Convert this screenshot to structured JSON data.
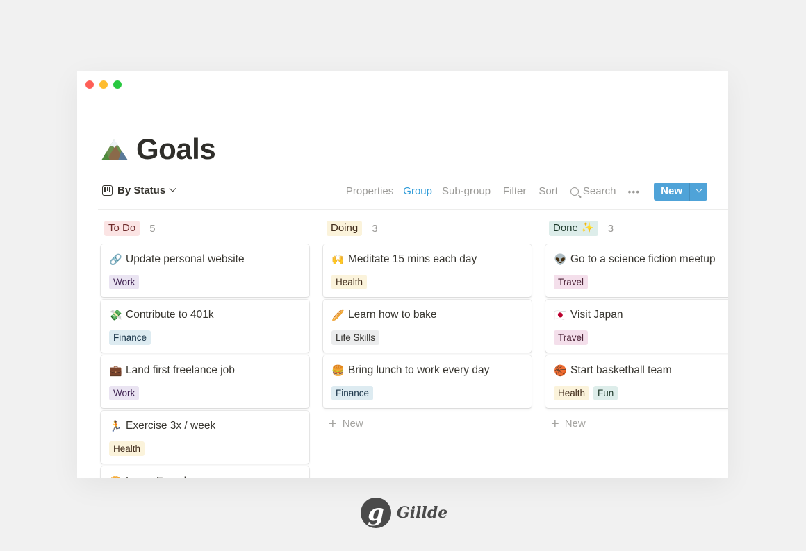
{
  "window": {
    "controls": [
      "close",
      "minimize",
      "maximize"
    ]
  },
  "page": {
    "icon": "snow-capped-mountain-icon",
    "title": "Goals"
  },
  "toolbar": {
    "view_label": "By Status",
    "actions": {
      "properties": "Properties",
      "group": "Group",
      "subgroup": "Sub-group",
      "filter": "Filter",
      "sort": "Sort",
      "search": "Search",
      "more": "•••"
    },
    "active_action": "Group",
    "new_label": "New",
    "accent_color": "#4fa3d8"
  },
  "board": {
    "columns": [
      {
        "status": "To Do",
        "count": "5",
        "pill_bg": "#fbe4e4",
        "pill_fg": "#6f2b2b",
        "cards": [
          {
            "emoji": "🔗",
            "icon": "link-icon",
            "title": "Update personal website",
            "tags": [
              {
                "label": "Work",
                "bg": "#eae4f2",
                "fg": "#412454"
              }
            ]
          },
          {
            "emoji": "💸",
            "icon": "money-with-wings-icon",
            "title": "Contribute to 401k",
            "tags": [
              {
                "label": "Finance",
                "bg": "#ddebf1",
                "fg": "#183347"
              }
            ]
          },
          {
            "emoji": "💼",
            "icon": "briefcase-icon",
            "title": "Land first freelance job",
            "tags": [
              {
                "label": "Work",
                "bg": "#eae4f2",
                "fg": "#412454"
              }
            ]
          },
          {
            "emoji": "🏃",
            "icon": "runner-icon",
            "title": "Exercise 3x / week",
            "tags": [
              {
                "label": "Health",
                "bg": "#fbf3db",
                "fg": "#402c1b"
              }
            ]
          },
          {
            "emoji": "🥐",
            "icon": "croissant-icon",
            "title": "Learn French",
            "tags": []
          }
        ],
        "show_new": false
      },
      {
        "status": "Doing",
        "count": "3",
        "pill_bg": "#fbf3db",
        "pill_fg": "#402c1b",
        "cards": [
          {
            "emoji": "🙌",
            "icon": "raised-hands-icon",
            "title": "Meditate 15 mins each day",
            "tags": [
              {
                "label": "Health",
                "bg": "#fbf3db",
                "fg": "#402c1b"
              }
            ]
          },
          {
            "emoji": "🥖",
            "icon": "baguette-icon",
            "title": "Learn how to bake",
            "tags": [
              {
                "label": "Life Skills",
                "bg": "#ebeced",
                "fg": "#32302c"
              }
            ]
          },
          {
            "emoji": "🍔",
            "icon": "burger-icon",
            "title": "Bring lunch to work every day",
            "tags": [
              {
                "label": "Finance",
                "bg": "#ddebf1",
                "fg": "#183347"
              }
            ]
          }
        ],
        "show_new": true,
        "new_label": "New"
      },
      {
        "status": "Done ✨",
        "count": "3",
        "pill_bg": "#ddedea",
        "pill_fg": "#1c3829",
        "cards": [
          {
            "emoji": "👽",
            "icon": "alien-icon",
            "title": "Go to a science fiction meetup",
            "tags": [
              {
                "label": "Travel",
                "bg": "#f4dfeb",
                "fg": "#4c2337"
              }
            ]
          },
          {
            "emoji": "🇯🇵",
            "icon": "japan-flag-icon",
            "title": "Visit Japan",
            "tags": [
              {
                "label": "Travel",
                "bg": "#f4dfeb",
                "fg": "#4c2337"
              }
            ]
          },
          {
            "emoji": "🏀",
            "icon": "basketball-icon",
            "title": "Start basketball team",
            "tags": [
              {
                "label": "Health",
                "bg": "#fbf3db",
                "fg": "#402c1b"
              },
              {
                "label": "Fun",
                "bg": "#ddedea",
                "fg": "#1c3829"
              }
            ]
          }
        ],
        "show_new": true,
        "new_label": "New"
      }
    ]
  },
  "branding": {
    "logo_letter": "g",
    "name": "Gillde"
  }
}
